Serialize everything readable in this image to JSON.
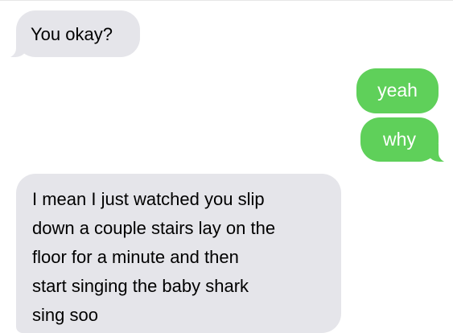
{
  "conversation": {
    "messages": [
      {
        "direction": "received",
        "text": "You okay?"
      },
      {
        "direction": "sent",
        "text": "yeah"
      },
      {
        "direction": "sent",
        "text": "why"
      },
      {
        "direction": "received",
        "text": "I mean I just watched you slip\ndown a couple stairs lay on the\nfloor for a minute and then\nstart singing the baby shark\nsing soo"
      }
    ]
  },
  "colors": {
    "sent_bubble": "#5fd05a",
    "received_bubble": "#e5e5ea",
    "background": "#ffffff"
  }
}
